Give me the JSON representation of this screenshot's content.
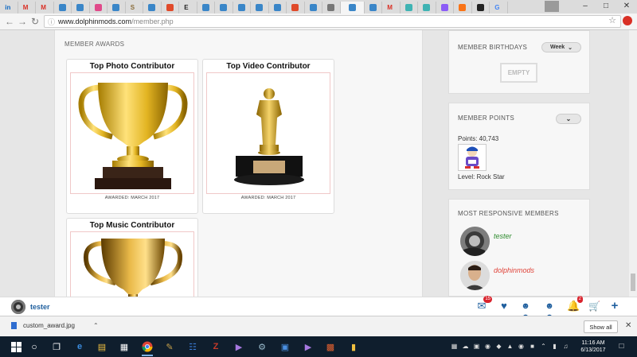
{
  "browser": {
    "url_host": "www.dolphinmods.com",
    "url_path": "/member.php",
    "tabs": [
      {
        "color": "#0a66c2",
        "label": "in"
      },
      {
        "color": "#d93025",
        "label": "M"
      },
      {
        "color": "#d93025",
        "label": "M"
      },
      {
        "color": "#3a86c8",
        "label": ""
      },
      {
        "color": "#3a86c8",
        "label": ""
      },
      {
        "color": "#e04a8a",
        "label": ""
      },
      {
        "color": "#3a86c8",
        "label": ""
      },
      {
        "color": "#8a6d3b",
        "label": "S"
      },
      {
        "color": "#3a86c8",
        "label": ""
      },
      {
        "color": "#e04a2a",
        "label": ""
      },
      {
        "color": "#222222",
        "label": "E"
      },
      {
        "color": "#3a86c8",
        "label": ""
      },
      {
        "color": "#3a86c8",
        "label": ""
      },
      {
        "color": "#3a86c8",
        "label": ""
      },
      {
        "color": "#3a86c8",
        "label": ""
      },
      {
        "color": "#3a86c8",
        "label": ""
      },
      {
        "color": "#e04a2a",
        "label": ""
      },
      {
        "color": "#3a86c8",
        "label": ""
      },
      {
        "color": "#777777",
        "label": ""
      },
      {
        "color": "#3a86c8",
        "label": ""
      },
      {
        "color": "#3a86c8",
        "label": ""
      },
      {
        "color": "#d93025",
        "label": "M"
      },
      {
        "color": "#3fb3b3",
        "label": ""
      },
      {
        "color": "#3fb3b3",
        "label": ""
      },
      {
        "color": "#8b5cf6",
        "label": ""
      },
      {
        "color": "#f97316",
        "label": ""
      },
      {
        "color": "#222222",
        "label": ""
      },
      {
        "color": "#4285f4",
        "label": "G"
      }
    ]
  },
  "awards": {
    "section_title": "MEMBER AWARDS",
    "items": [
      {
        "title": "Top Photo Contributor",
        "awarded": "AWARDED:  MARCH 2017",
        "kind": "trophy-photo"
      },
      {
        "title": "Top Video Contributor",
        "awarded": "AWARDED:  MARCH 2017",
        "kind": "trophy-video"
      },
      {
        "title": "Top Music Contributor",
        "awarded": "",
        "kind": "trophy-music"
      }
    ]
  },
  "sidebar": {
    "birthdays": {
      "title": "MEMBER BIRTHDAYS",
      "filter": "Week",
      "empty_label": "EMPTY"
    },
    "points": {
      "title": "MEMBER POINTS",
      "points_text": "Points: 40,743",
      "level_text": "Level: Rock Star"
    },
    "responsive": {
      "title": "MOST RESPONSIVE MEMBERS",
      "members": [
        {
          "name": "tester",
          "color": "#2e8b2e"
        },
        {
          "name": "dolphinmods",
          "color": "#e0443a"
        }
      ]
    }
  },
  "footer": {
    "username": "tester",
    "messages_badge": "15",
    "notifications_badge": "2"
  },
  "downloads": {
    "file": "custom_award.jpg",
    "show_all": "Show all"
  },
  "taskbar": {
    "time": "11:16 AM",
    "date": "6/13/2017"
  },
  "colors": {
    "accent": "#1f5f9e",
    "badge": "#d9232d",
    "gold": "#d4a017"
  }
}
